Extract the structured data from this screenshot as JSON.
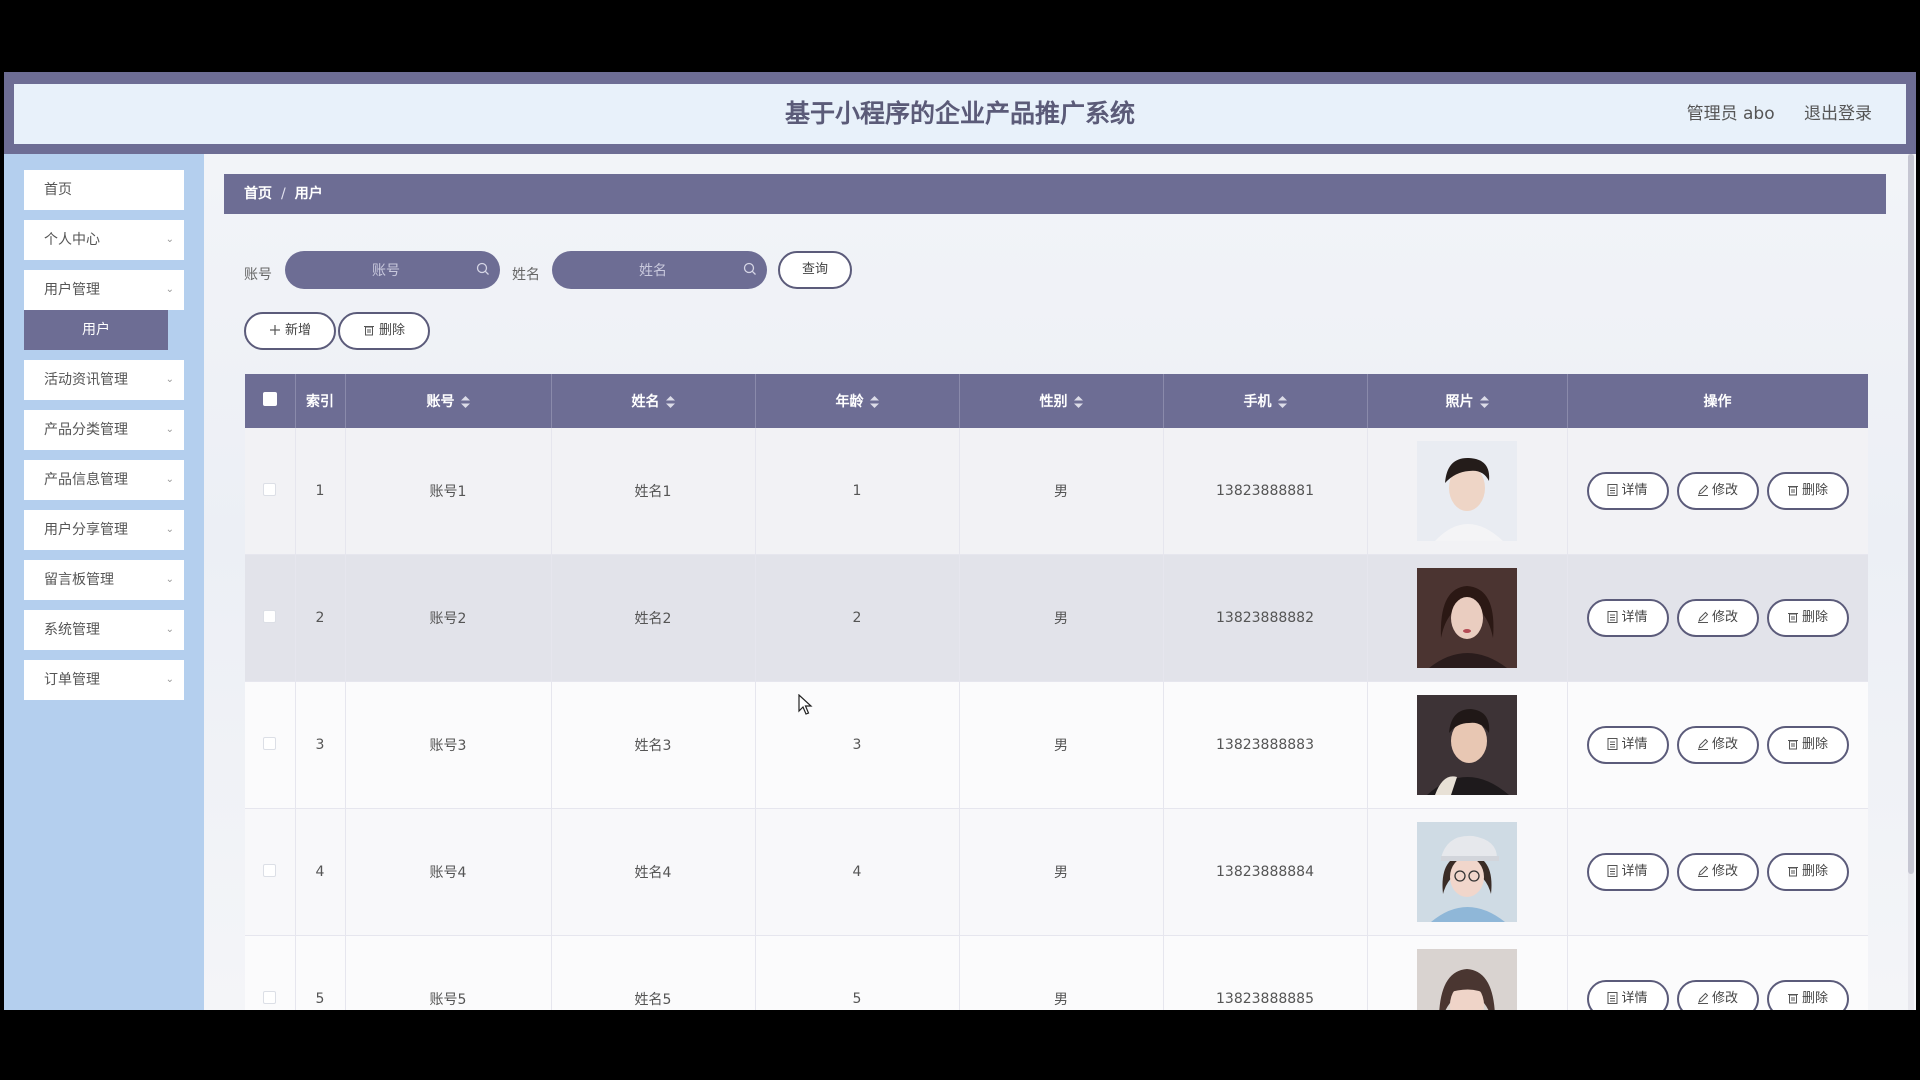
{
  "header": {
    "title": "基于小程序的企业产品推广系统",
    "user_label": "管理员 abo",
    "logout_label": "退出登录"
  },
  "sidebar": {
    "items": [
      {
        "label": "首页",
        "has_children": false
      },
      {
        "label": "个人中心",
        "has_children": true
      },
      {
        "label": "用户管理",
        "has_children": true
      },
      {
        "label": "活动资讯管理",
        "has_children": true
      },
      {
        "label": "产品分类管理",
        "has_children": true
      },
      {
        "label": "产品信息管理",
        "has_children": true
      },
      {
        "label": "用户分享管理",
        "has_children": true
      },
      {
        "label": "留言板管理",
        "has_children": true
      },
      {
        "label": "系统管理",
        "has_children": true
      },
      {
        "label": "订单管理",
        "has_children": true
      }
    ],
    "active_subitem": "用户"
  },
  "breadcrumb": {
    "home": "首页",
    "separator": "/",
    "current": "用户"
  },
  "search": {
    "account_label": "账号",
    "account_placeholder": "账号",
    "name_label": "姓名",
    "name_placeholder": "姓名",
    "query_button": "查询"
  },
  "actions": {
    "add_button": "新增",
    "delete_button": "删除"
  },
  "table": {
    "columns": [
      "索引",
      "账号",
      "姓名",
      "年龄",
      "性别",
      "手机",
      "照片",
      "操作"
    ],
    "row_actions": {
      "detail": "详情",
      "edit": "修改",
      "delete": "删除"
    },
    "rows": [
      {
        "index": "1",
        "account": "账号1",
        "name": "姓名1",
        "age": "1",
        "gender": "男",
        "phone": "13823888881"
      },
      {
        "index": "2",
        "account": "账号2",
        "name": "姓名2",
        "age": "2",
        "gender": "男",
        "phone": "13823888882"
      },
      {
        "index": "3",
        "account": "账号3",
        "name": "姓名3",
        "age": "3",
        "gender": "男",
        "phone": "13823888883"
      },
      {
        "index": "4",
        "account": "账号4",
        "name": "姓名4",
        "age": "4",
        "gender": "男",
        "phone": "13823888884"
      },
      {
        "index": "5",
        "account": "账号5",
        "name": "姓名5",
        "age": "5",
        "gender": "男",
        "phone": "13823888885"
      }
    ]
  },
  "colors": {
    "primary": "#6d6d94",
    "sidebar_bg": "#b4cfee",
    "header_bg": "#e8f1fa"
  }
}
